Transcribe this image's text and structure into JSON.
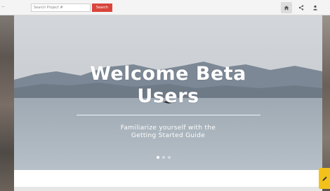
{
  "search": {
    "placeholder": "Search Project #",
    "button_label": "Search"
  },
  "topnav": {
    "items": [
      {
        "icon": "home-icon",
        "active": true
      },
      {
        "icon": "share-icon",
        "active": false
      },
      {
        "icon": "user-icon",
        "active": false
      }
    ]
  },
  "hero": {
    "title_line1": "Welcome Beta",
    "title_line2": "Users",
    "subtitle_line1": "Familiarize yourself with the",
    "subtitle_line2": "Getting Started Guide",
    "slide_count": 3,
    "active_slide": 1
  },
  "help_tab": {
    "icon": "pencil-icon"
  },
  "colors": {
    "accent": "#d9453c",
    "help_tab": "#f2c21a",
    "hero_text": "#ffffff"
  }
}
